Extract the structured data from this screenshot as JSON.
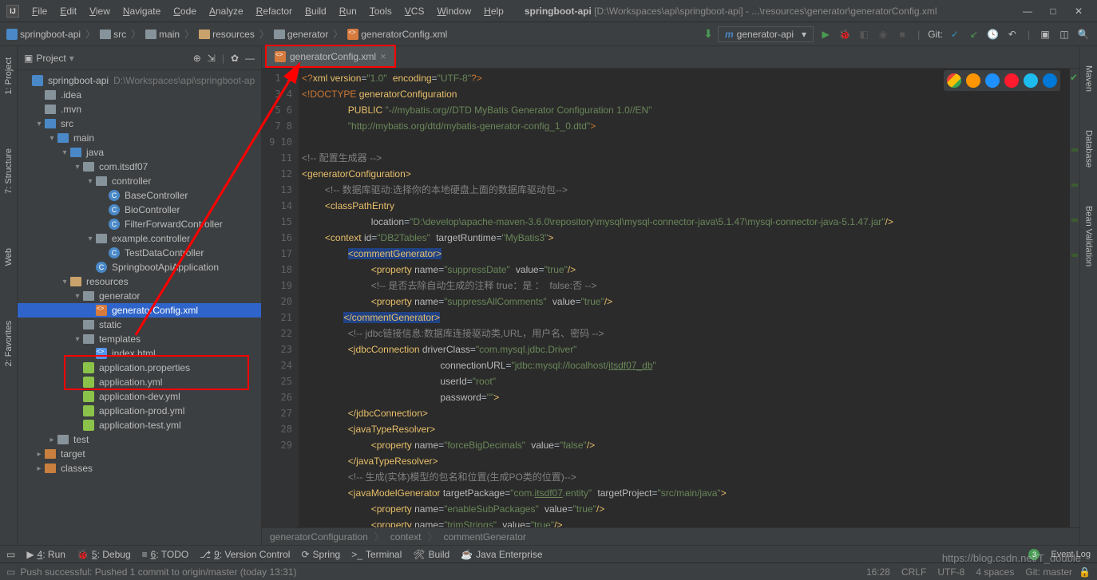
{
  "title": {
    "app": "springboot-api",
    "path": "[D:\\Workspaces\\api\\springboot-api] - ...\\resources\\generator\\generatorConfig.xml"
  },
  "menu": [
    "File",
    "Edit",
    "View",
    "Navigate",
    "Code",
    "Analyze",
    "Refactor",
    "Build",
    "Run",
    "Tools",
    "VCS",
    "Window",
    "Help"
  ],
  "breadcrumb": [
    {
      "icon": "module",
      "label": "springboot-api"
    },
    {
      "icon": "folder",
      "label": "src"
    },
    {
      "icon": "folder",
      "label": "main"
    },
    {
      "icon": "folder-res",
      "label": "resources"
    },
    {
      "icon": "folder",
      "label": "generator"
    },
    {
      "icon": "xml",
      "label": "generatorConfig.xml"
    }
  ],
  "runConfig": {
    "prefix": "m",
    "label": "generator-api"
  },
  "git_label": "Git:",
  "panel": {
    "title": "Project"
  },
  "tree": [
    {
      "d": 0,
      "a": "",
      "i": "module",
      "l": "springboot-api",
      "x": "D:\\Workspaces\\api\\springboot-ap"
    },
    {
      "d": 1,
      "a": "",
      "i": "folder",
      "l": ".idea"
    },
    {
      "d": 1,
      "a": "",
      "i": "folder",
      "l": ".mvn"
    },
    {
      "d": 1,
      "a": "▾",
      "i": "folder-blue",
      "l": "src"
    },
    {
      "d": 2,
      "a": "▾",
      "i": "folder-blue",
      "l": "main"
    },
    {
      "d": 3,
      "a": "▾",
      "i": "folder-blue",
      "l": "java"
    },
    {
      "d": 4,
      "a": "▾",
      "i": "folder",
      "l": "com.itsdf07"
    },
    {
      "d": 5,
      "a": "▾",
      "i": "folder",
      "l": "controller"
    },
    {
      "d": 6,
      "a": "",
      "i": "class",
      "l": "BaseController"
    },
    {
      "d": 6,
      "a": "",
      "i": "class",
      "l": "BioController"
    },
    {
      "d": 6,
      "a": "",
      "i": "class",
      "l": "FilterForwardController"
    },
    {
      "d": 5,
      "a": "▾",
      "i": "folder",
      "l": "example.controller"
    },
    {
      "d": 6,
      "a": "",
      "i": "class",
      "l": "TestDataController"
    },
    {
      "d": 5,
      "a": "",
      "i": "class",
      "l": "SpringbootApiApplication"
    },
    {
      "d": 3,
      "a": "▾",
      "i": "folder-res",
      "l": "resources"
    },
    {
      "d": 4,
      "a": "▾",
      "i": "folder",
      "l": "generator",
      "box": true
    },
    {
      "d": 5,
      "a": "",
      "i": "xml",
      "l": "generatorConfig.xml",
      "sel": true,
      "box": true
    },
    {
      "d": 4,
      "a": "",
      "i": "folder",
      "l": "static"
    },
    {
      "d": 4,
      "a": "▾",
      "i": "folder",
      "l": "templates"
    },
    {
      "d": 5,
      "a": "",
      "i": "html",
      "l": "index.html"
    },
    {
      "d": 4,
      "a": "",
      "i": "yml",
      "l": "application.properties"
    },
    {
      "d": 4,
      "a": "",
      "i": "yml",
      "l": "application.yml"
    },
    {
      "d": 4,
      "a": "",
      "i": "yml",
      "l": "application-dev.yml"
    },
    {
      "d": 4,
      "a": "",
      "i": "yml",
      "l": "application-prod.yml"
    },
    {
      "d": 4,
      "a": "",
      "i": "yml",
      "l": "application-test.yml"
    },
    {
      "d": 2,
      "a": "▸",
      "i": "folder",
      "l": "test"
    },
    {
      "d": 1,
      "a": "▸",
      "i": "folder-o",
      "l": "target"
    },
    {
      "d": 1,
      "a": "▸",
      "i": "folder-o",
      "l": "classes"
    }
  ],
  "tab": {
    "label": "generatorConfig.xml"
  },
  "lines_start": 1,
  "editor_crumbs": [
    "generatorConfiguration",
    "context",
    "commentGenerator"
  ],
  "left_tabs": [
    "1: Project",
    "7: Structure",
    "Web",
    "2: Favorites"
  ],
  "right_tabs": [
    "Maven",
    "Database",
    "Bean Validation"
  ],
  "bottom": [
    {
      "k": "▶",
      "l": "4: Run"
    },
    {
      "k": "🐞",
      "l": "5: Debug"
    },
    {
      "k": "≡",
      "l": "6: TODO"
    },
    {
      "k": "⎇",
      "l": "9: Version Control"
    },
    {
      "k": "⟳",
      "l": "Spring"
    },
    {
      "k": ">_",
      "l": "Terminal"
    },
    {
      "k": "🛠",
      "l": "Build"
    },
    {
      "k": "☕",
      "l": "Java Enterprise"
    }
  ],
  "event_log": "Event Log",
  "status": {
    "msg": "Push successful: Pushed 1 commit to origin/master (today 13:31)",
    "right": [
      "16:28",
      "CRLF",
      "UTF-8",
      "4 spaces",
      "Git: master"
    ]
  },
  "watermark": "https://blog.csdn.net/T_double"
}
